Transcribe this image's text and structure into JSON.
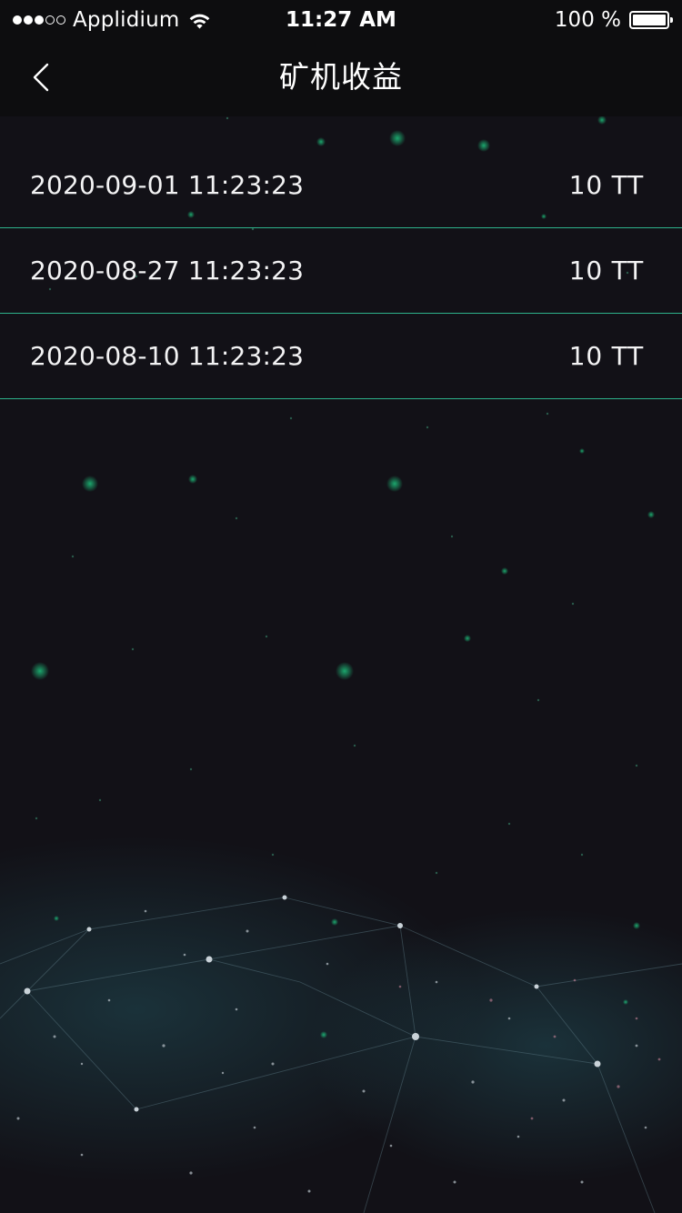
{
  "status_bar": {
    "signal_dots": [
      true,
      true,
      true,
      false,
      false
    ],
    "carrier": "Applidium",
    "time": "11:27 AM",
    "battery": "100 %",
    "battery_level": 1.0
  },
  "nav": {
    "title": "矿机收益",
    "back_icon": "chevron-left-icon"
  },
  "records": [
    {
      "date": "2020-09-01 11:23:23",
      "amount": "10 TT"
    },
    {
      "date": "2020-08-27 11:23:23",
      "amount": "10 TT"
    },
    {
      "date": "2020-08-10 11:23:23",
      "amount": "10 TT"
    }
  ],
  "colors": {
    "background": "#121117",
    "bar": "#0d0d0f",
    "divider": "#2db28b",
    "text": "#ffffff"
  }
}
